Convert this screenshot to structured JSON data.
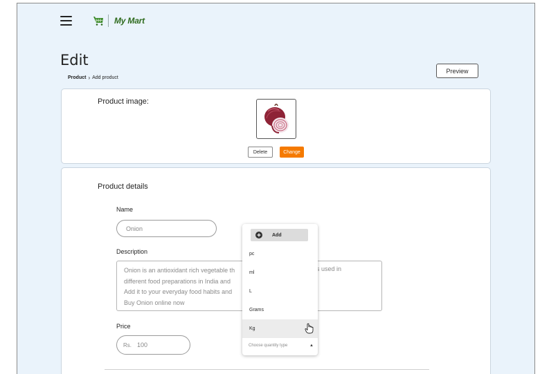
{
  "header": {
    "logo_text": "My Mart"
  },
  "page": {
    "title": "Edit",
    "breadcrumb": {
      "parent": "Product",
      "current": "Add product"
    },
    "preview_label": "Preview"
  },
  "image_section": {
    "label": "Product image:",
    "delete_label": "Delete",
    "change_label": "Change"
  },
  "details": {
    "title": "Product details",
    "name_label": "Name",
    "name_value": "Onion",
    "description_label": "Description",
    "description_lines": [
      "Onion is an antioxidant rich vegetable th",
      "different food preparations in India and",
      "Add it to your everyday food habits and",
      "Buy Onion online now"
    ],
    "description_tail": "s used in",
    "price_label": "Price",
    "price_currency": "Rs.",
    "price_value": "100"
  },
  "quantity_dropdown": {
    "add_label": "Add",
    "options": [
      "pc",
      "ml",
      "L",
      "Grams",
      "Kg"
    ],
    "hovered": "Kg",
    "placeholder": "Choose quantity type"
  },
  "colors": {
    "accent_orange": "#f57a00",
    "background_blue": "#eaf3fb",
    "logo_green": "#2f6b1e"
  },
  "icons": [
    "menu-icon",
    "shopping-cart-icon",
    "chevron-right-icon",
    "plus-circle-icon",
    "hand-pointer-icon",
    "caret-up-icon"
  ]
}
